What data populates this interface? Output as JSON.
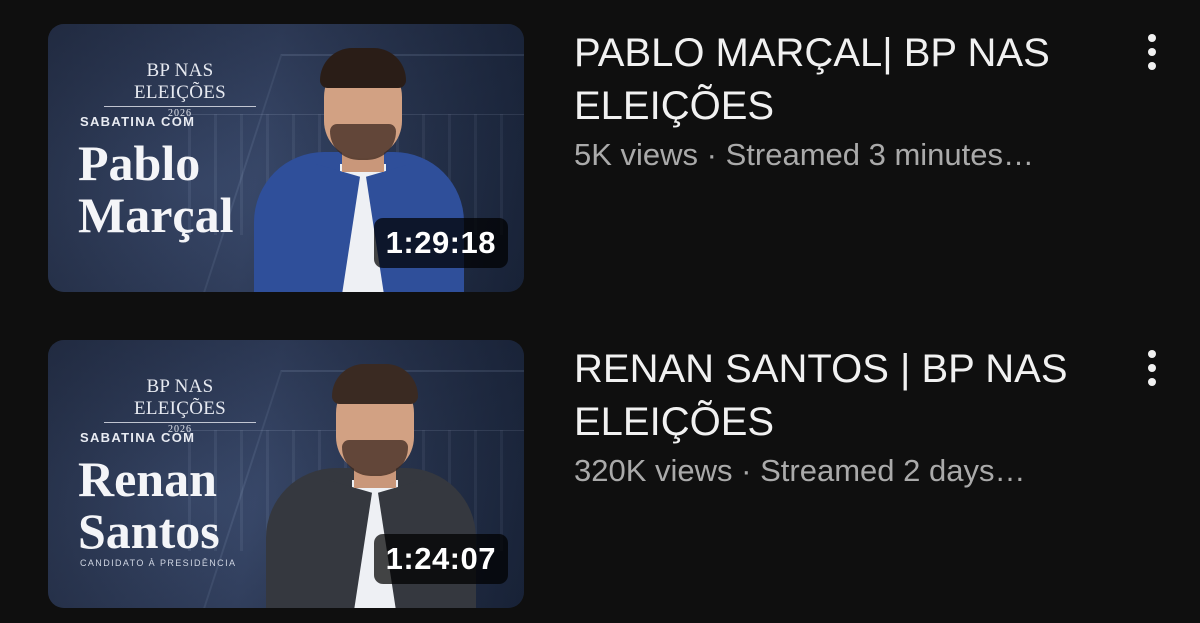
{
  "videos": [
    {
      "thumbnail": {
        "brand": "BP NAS ELEIÇÕES",
        "brand_year": "2026",
        "kicker": "SABATINA COM",
        "name_line1": "Pablo",
        "name_line2": "Marçal",
        "subcaption": "",
        "duration": "1:29:18"
      },
      "title": "PABLO MARÇAL| BP NAS ELEIÇÕES",
      "views": "5K views",
      "separator": " · ",
      "streamed": "Streamed 3 minutes…"
    },
    {
      "thumbnail": {
        "brand": "BP NAS ELEIÇÕES",
        "brand_year": "2026",
        "kicker": "SABATINA COM",
        "name_line1": "Renan",
        "name_line2": "Santos",
        "subcaption": "CANDIDATO À PRESIDÊNCIA",
        "duration": "1:24:07"
      },
      "title": "RENAN SANTOS | BP NAS ELEIÇÕES",
      "views": "320K views",
      "separator": " · ",
      "streamed": "Streamed 2 days…"
    }
  ],
  "icons": {
    "more": "more-vert-icon"
  }
}
